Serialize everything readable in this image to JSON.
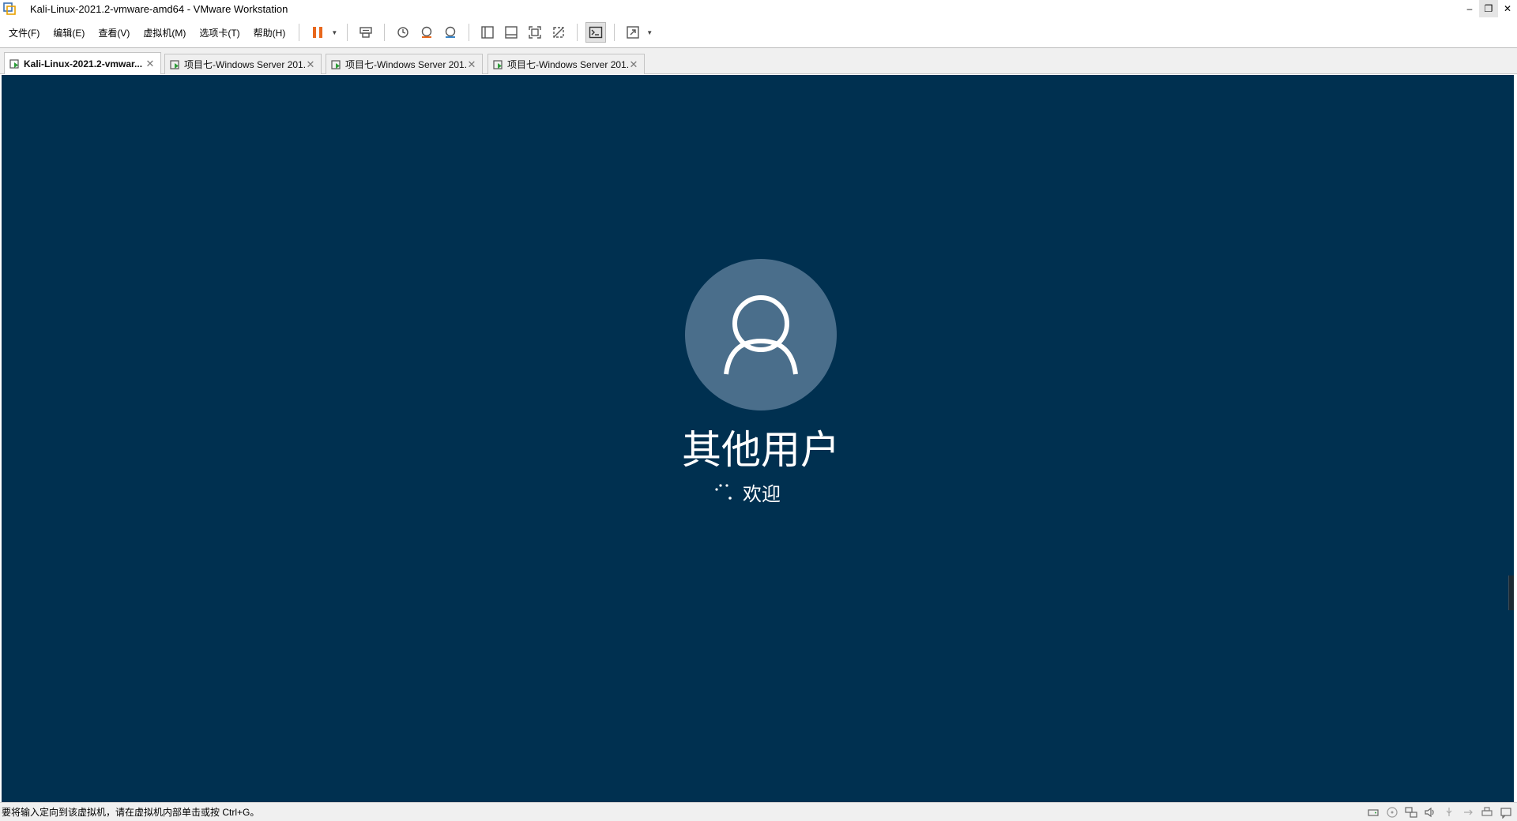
{
  "window": {
    "title": "Kali-Linux-2021.2-vmware-amd64 - VMware Workstation",
    "controls": {
      "minimize": "–",
      "restore": "❐",
      "close": "✕"
    }
  },
  "menu": {
    "items": [
      "文件(F)",
      "编辑(E)",
      "查看(V)",
      "虚拟机(M)",
      "选项卡(T)",
      "帮助(H)"
    ]
  },
  "toolbar": {
    "icons": [
      "pause-icon",
      "send-keys-icon",
      "snapshot-icon",
      "revert-snapshot-icon",
      "snapshot-manager-icon",
      "library-icon",
      "thumbnail-bar-icon",
      "full-screen-icon",
      "unity-icon",
      "console-view-icon",
      "stretch-icon"
    ],
    "accent": "#e8671c"
  },
  "tabs": [
    {
      "label": "Kali-Linux-2021.2-vmwar...",
      "active": true
    },
    {
      "label": "项目七-Windows Server 201...",
      "active": false
    },
    {
      "label": "项目七-Windows Server 201...",
      "active": false
    },
    {
      "label": "项目七-Windows Server 201...",
      "active": false
    }
  ],
  "vm": {
    "background": "#003050",
    "user_name": "其他用户",
    "welcome_text": "欢迎"
  },
  "statusbar": {
    "hint": "要将输入定向到该虚拟机，请在虚拟机内部单击或按 Ctrl+G。",
    "icons": [
      "hard-disk-icon",
      "cd-drive-icon",
      "network-icon",
      "sound-icon",
      "usb-icon",
      "printer-icon",
      "message-icon"
    ]
  }
}
